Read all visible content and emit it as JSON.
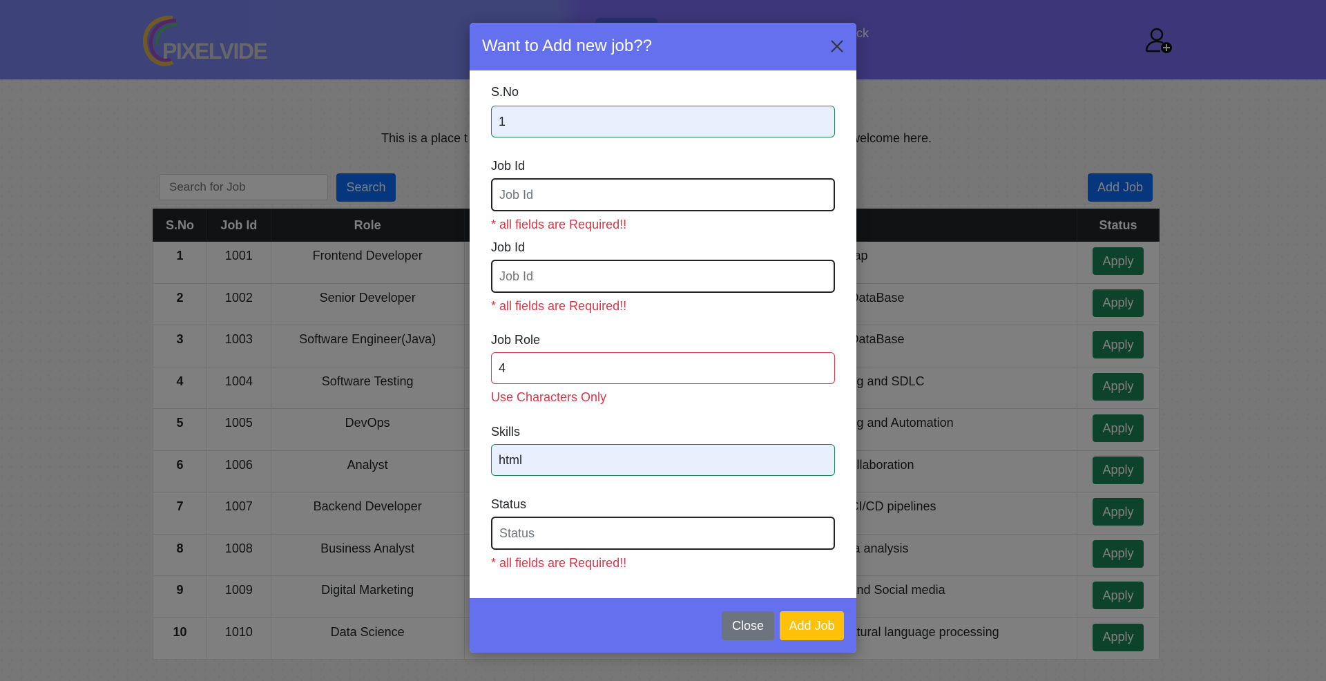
{
  "brand": {
    "logo_text": "PIXELVIDE"
  },
  "nav": {
    "link_partial": "ack"
  },
  "intro": {
    "left_text": "This is a place t",
    "right_text": "welcome here."
  },
  "search": {
    "placeholder": "Search for Job",
    "button_label": "Search"
  },
  "add_job_button": "Add Job",
  "table": {
    "headers": [
      "S.No",
      "Job Id",
      "Role",
      "",
      "Status"
    ],
    "rows": [
      {
        "sno": "1",
        "job_id": "1001",
        "role": "Frontend Developer",
        "skills": "rap",
        "action": "Apply"
      },
      {
        "sno": "2",
        "job_id": "1002",
        "role": "Senior Developer",
        "skills": " DataBase",
        "action": "Apply"
      },
      {
        "sno": "3",
        "job_id": "1003",
        "role": "Software Engineer(Java)",
        "skills": " DataBase",
        "action": "Apply"
      },
      {
        "sno": "4",
        "job_id": "1004",
        "role": "Software Testing",
        "skills": "ng and SDLC",
        "action": "Apply"
      },
      {
        "sno": "5",
        "job_id": "1005",
        "role": "DevOps",
        "skills": "ng and Automation",
        "action": "Apply"
      },
      {
        "sno": "6",
        "job_id": "1006",
        "role": "Analyst",
        "skills": "ollaboration",
        "action": "Apply"
      },
      {
        "sno": "7",
        "job_id": "1007",
        "role": "Backend Developer",
        "skills": "CI/CD pipelines",
        "action": "Apply"
      },
      {
        "sno": "8",
        "job_id": "1008",
        "role": "Business Analyst",
        "skills": "ta analysis",
        "action": "Apply"
      },
      {
        "sno": "9",
        "job_id": "1009",
        "role": "Digital Marketing",
        "skills": "and Social media",
        "action": "Apply"
      },
      {
        "sno": "10",
        "job_id": "1010",
        "role": "Data Science",
        "skills": "atural language processing",
        "action": "Apply"
      }
    ]
  },
  "modal": {
    "title": "Want to Add new job??",
    "fields": {
      "sno": {
        "label": "S.No",
        "value": "1"
      },
      "job_id_1": {
        "label": "Job Id",
        "placeholder": "Job Id",
        "error": "* all fields are Required!!"
      },
      "job_id_2": {
        "label": "Job Id",
        "placeholder": "Job Id",
        "error": "* all fields are Required!!"
      },
      "job_role": {
        "label": "Job Role",
        "value": "4",
        "error": "Use Characters Only"
      },
      "skills": {
        "label": "Skills",
        "value": "html"
      },
      "status": {
        "label": "Status",
        "placeholder": "Status",
        "error": "* all fields are Required!!"
      }
    },
    "close_label": "Close",
    "add_label": "Add Job"
  },
  "colors": {
    "navbar": "#7b6ff3",
    "modal_header": "#6570ef",
    "primary": "#0d6efd",
    "success": "#198754",
    "danger": "#dc3545",
    "warning": "#ffc107",
    "secondary": "#6c757d"
  },
  "icons": {
    "user": "user-plus-icon",
    "close": "close-icon"
  }
}
